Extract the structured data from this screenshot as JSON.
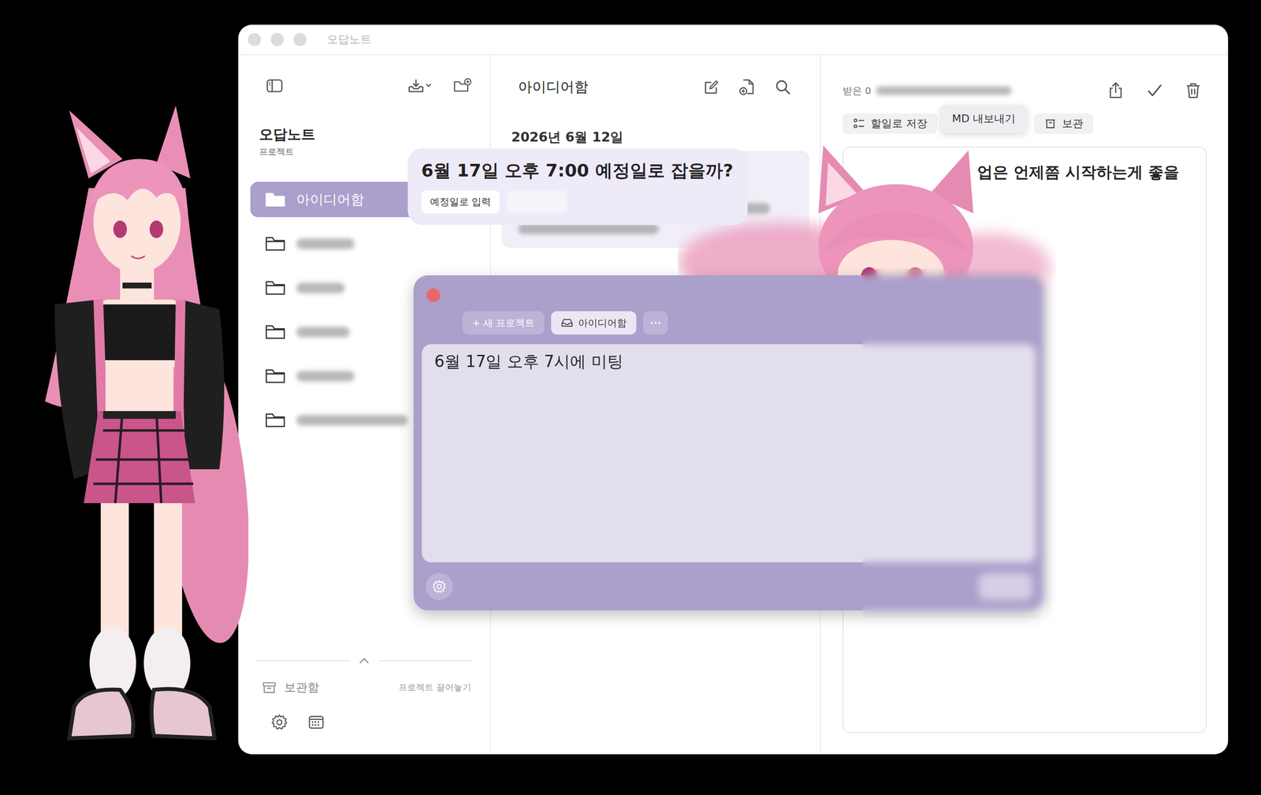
{
  "window": {
    "title": "오답노트"
  },
  "sidebar": {
    "title": "오답노트",
    "section": "프로젝트",
    "items": [
      {
        "label": "아이디어함",
        "selected": true,
        "blurred": false
      },
      {
        "selected": false,
        "blurred": true
      },
      {
        "selected": false,
        "blurred": true
      },
      {
        "selected": false,
        "blurred": true
      },
      {
        "selected": false,
        "blurred": true
      },
      {
        "selected": false,
        "blurred": true
      }
    ],
    "archive": "보관함",
    "hint": "프로젝트 끌어놓기"
  },
  "list": {
    "title": "아이디어함",
    "date": "2026년 6월 12일"
  },
  "detail": {
    "received": "받은 0",
    "actions": [
      {
        "label": "할일로 저장",
        "kind": "todo"
      },
      {
        "label": "보관",
        "kind": "archive"
      }
    ],
    "tooltip": "MD 내보내기",
    "body": "업은 언제쯤 시작하는게 좋을"
  },
  "suggestion": {
    "text": "6월 17일 오후 7:00 예정일로 잡을까?",
    "buttons": [
      {
        "label": "예정일로 입력",
        "blurred": false
      },
      {
        "blurred": true
      }
    ]
  },
  "capture": {
    "buttons": [
      {
        "label": "+ 새 프로젝트",
        "kind": "new"
      },
      {
        "label": "아이디어함",
        "kind": "inbox"
      },
      {
        "label": "···",
        "kind": "more"
      }
    ],
    "text": "6월 17일 오후 7시에 미팅"
  }
}
